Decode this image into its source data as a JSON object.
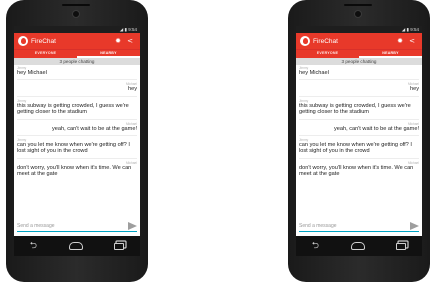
{
  "status": {
    "signal": "◢",
    "battery": "▮",
    "time": "9:54"
  },
  "app": {
    "title": "FireChat"
  },
  "icons": {
    "settings": "✹",
    "share": "<"
  },
  "tabs": {
    "everyone": "EVERYONE",
    "nearby": "NEARBY",
    "active": "nearby"
  },
  "chat": {
    "count_text": "3 people chatting",
    "messages": [
      {
        "sender": "Jimmy",
        "text": "hey Michael",
        "align": "left"
      },
      {
        "sender": "Michael",
        "text": "hey",
        "align": "right"
      },
      {
        "sender": "Jimmy",
        "text": "this subway is getting crowded, I guess we're getting closer to the stadium",
        "align": "left"
      },
      {
        "sender": "Michael",
        "text": "yeah, can't wait to be at the game!",
        "align": "right"
      },
      {
        "sender": "Jimmy",
        "text": "can you let me know when we're getting off? I lost sight of you in the crowd",
        "align": "left"
      },
      {
        "sender": "Michael",
        "text": "don't worry, you'll know when it's time. We can meet at the gate",
        "align": "left"
      }
    ]
  },
  "input": {
    "placeholder": "Send a message"
  },
  "colors": {
    "accent": "#e8392a",
    "input_underline": "#00a4c4",
    "device": "#1f1f1f"
  }
}
